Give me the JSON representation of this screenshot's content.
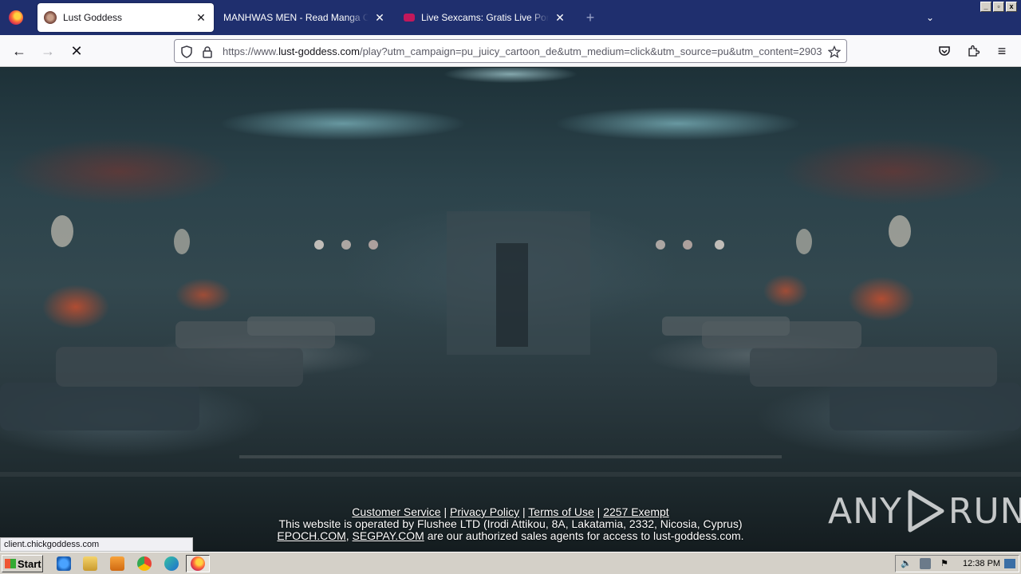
{
  "browser": {
    "tabs": [
      {
        "title": "Lust Goddess",
        "active": true
      },
      {
        "title": "MANHWAS MEN - Read Manga Online Free",
        "active": false
      },
      {
        "title": "Live Sexcams: Gratis Live Porn Chat",
        "active": false
      }
    ],
    "close_glyph": "✕",
    "newtab_glyph": "+",
    "tablist_glyph": "⌄",
    "window_controls": [
      "_",
      "▫",
      "x"
    ],
    "url": {
      "prefix": "https://www.",
      "domain": "lust-goddess.com",
      "path": "/play?utm_campaign=pu_juicy_cartoon_de&utm_medium=click&utm_source=pu&utm_content=2903"
    },
    "back_glyph": "←",
    "forward_glyph": "→",
    "stop_glyph": "✕",
    "menu_glyph": "≡"
  },
  "page": {
    "links": {
      "customer_service": "Customer Service",
      "privacy_policy": "Privacy Policy",
      "terms_of_use": "Terms of Use",
      "exempt": "2257 Exempt"
    },
    "separator": "|",
    "operated_by": "This website is operated by Flushee LTD (Irodi Attikou, 8A, Lakatamia, 2332, Nicosia, Cyprus)",
    "agents": {
      "epoch": "EPOCH.COM",
      "comma": ",",
      "segpay": "SEGPAY.COM",
      "rest": "are our authorized sales agents for access to lust-goddess.com."
    },
    "watermark_left": "ANY",
    "watermark_right": "RUN"
  },
  "status_text": "client.chickgoddess.com",
  "taskbar": {
    "start_label": "Start",
    "clock": "12:38 PM"
  }
}
